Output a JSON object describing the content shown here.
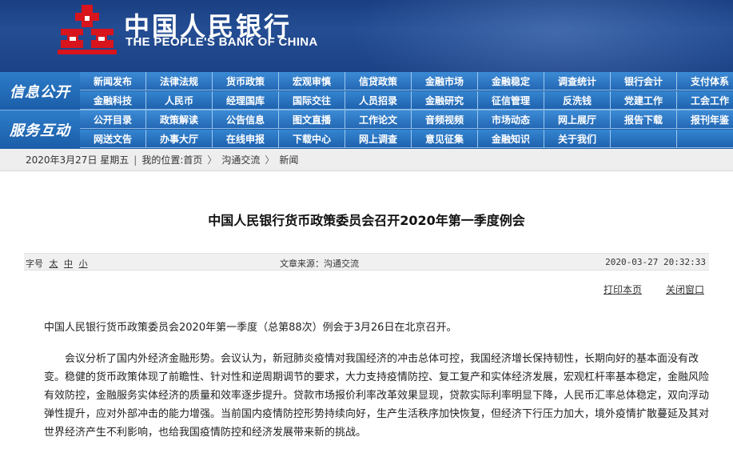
{
  "header": {
    "bank_name_cn": "中国人民银行",
    "bank_name_en": "THE PEOPLE'S BANK OF CHINA",
    "logo_icon": "pboc-emblem-icon"
  },
  "nav": {
    "section1_label": "信息公开",
    "section2_label": "服务互动",
    "section1_rows": [
      [
        "新闻发布",
        "法律法规",
        "货币政策",
        "宏观审慎",
        "信贷政策",
        "金融市场",
        "金融稳定",
        "调查统计",
        "银行会计",
        "支付体系"
      ],
      [
        "金融科技",
        "人民币",
        "经理国库",
        "国际交往",
        "人员招录",
        "金融研究",
        "征信管理",
        "反洗钱",
        "党建工作",
        "工会工作"
      ]
    ],
    "section2_rows": [
      [
        "公开目录",
        "政策解读",
        "公告信息",
        "图文直播",
        "工作论文",
        "音频视频",
        "市场动态",
        "网上展厅",
        "报告下载",
        "报刊年鉴"
      ],
      [
        "网送文告",
        "办事大厅",
        "在线申报",
        "下载中心",
        "网上调查",
        "意见征集",
        "金融知识",
        "关于我们",
        "",
        ""
      ]
    ]
  },
  "breadcrumb": {
    "date": "2020年3月27日 星期五",
    "location_label": "我的位置:",
    "home": "首页",
    "level1": "沟通交流",
    "level2": "新闻",
    "separator": "|",
    "arrow": "〉"
  },
  "article": {
    "title": "中国人民银行货币政策委员会召开2020年第一季度例会",
    "font_size_label": "字号",
    "font_size_options": [
      "太",
      "中",
      "小"
    ],
    "source": "文章来源：沟通交流",
    "datetime": "2020-03-27 20:32:33",
    "print_label": "打印本页",
    "close_label": "关闭窗口",
    "paragraphs": [
      "中国人民银行货币政策委员会2020年第一季度（总第88次）例会于3月26日在北京召开。",
      "会议分析了国内外经济金融形势。会议认为，新冠肺炎疫情对我国经济的冲击总体可控，我国经济增长保持韧性，长期向好的基本面没有改变。稳健的货币政策体现了前瞻性、针对性和逆周期调节的要求，大力支持疫情防控、复工复产和实体经济发展，宏观杠杆率基本稳定，金融风险有效防控，金融服务实体经济的质量和效率逐步提升。贷款市场报价利率改革效果显现，贷款实际利率明显下降，人民币汇率总体稳定，双向浮动弹性提升，应对外部冲击的能力增强。当前国内疫情防控形势持续向好，生产生活秩序加快恢复，但经济下行压力加大，境外疫情扩散蔓延及其对世界经济产生不利影响，也给我国疫情防控和经济发展带来新的挑战。"
    ]
  }
}
